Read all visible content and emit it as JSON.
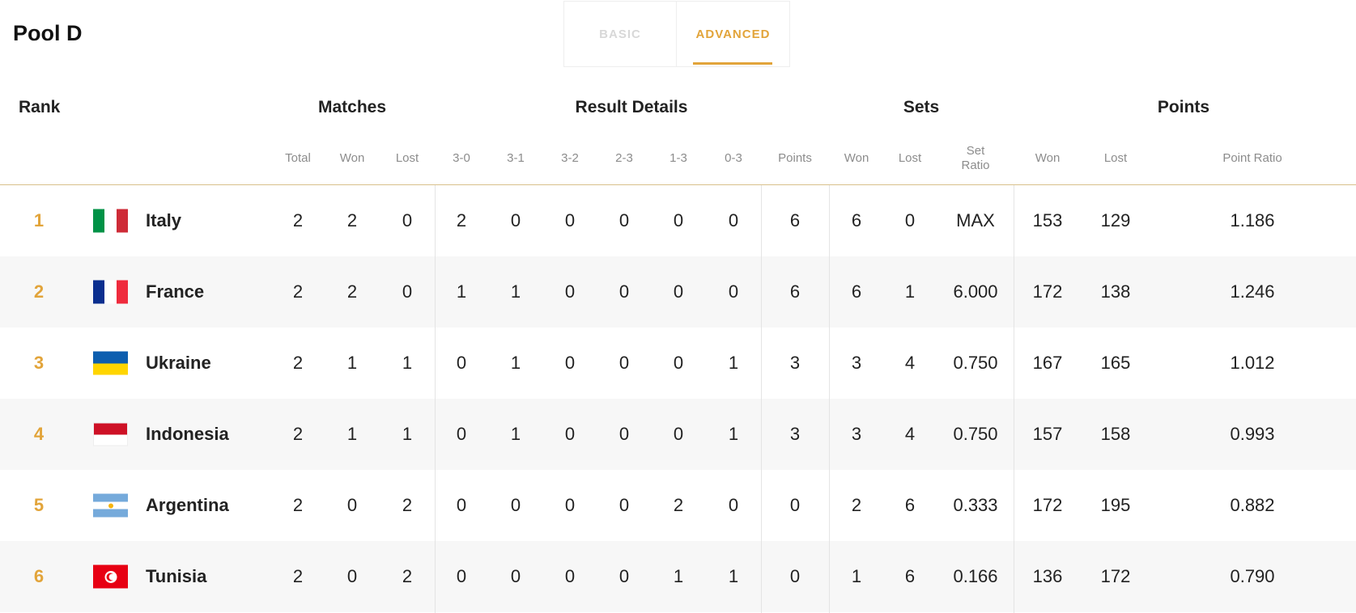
{
  "pool_title": "Pool D",
  "tabs": {
    "basic": "BASIC",
    "advanced": "ADVANCED",
    "active": "ADVANCED"
  },
  "accent_color": "#e2a43a",
  "groups": {
    "rank": "Rank",
    "matches": "Matches",
    "result_details": "Result Details",
    "sets": "Sets",
    "points": "Points"
  },
  "columns": {
    "matches_total": "Total",
    "matches_won": "Won",
    "matches_lost": "Lost",
    "r30": "3-0",
    "r31": "3-1",
    "r32": "3-2",
    "r23": "2-3",
    "r13": "1-3",
    "r03": "0-3",
    "points": "Points",
    "sets_won": "Won",
    "sets_lost": "Lost",
    "set_ratio": "Set Ratio",
    "points_won": "Won",
    "points_lost": "Lost",
    "point_ratio": "Point Ratio"
  },
  "rows": [
    {
      "rank": "1",
      "country": "Italy",
      "flag": "italy-flag-icon",
      "total": "2",
      "won": "2",
      "lost": "0",
      "r30": "2",
      "r31": "0",
      "r32": "0",
      "r23": "0",
      "r13": "0",
      "r03": "0",
      "points": "6",
      "sets_won": "6",
      "sets_lost": "0",
      "set_ratio": "MAX",
      "points_won": "153",
      "points_lost": "129",
      "point_ratio": "1.186"
    },
    {
      "rank": "2",
      "country": "France",
      "flag": "france-flag-icon",
      "total": "2",
      "won": "2",
      "lost": "0",
      "r30": "1",
      "r31": "1",
      "r32": "0",
      "r23": "0",
      "r13": "0",
      "r03": "0",
      "points": "6",
      "sets_won": "6",
      "sets_lost": "1",
      "set_ratio": "6.000",
      "points_won": "172",
      "points_lost": "138",
      "point_ratio": "1.246"
    },
    {
      "rank": "3",
      "country": "Ukraine",
      "flag": "ukraine-flag-icon",
      "total": "2",
      "won": "1",
      "lost": "1",
      "r30": "0",
      "r31": "1",
      "r32": "0",
      "r23": "0",
      "r13": "0",
      "r03": "1",
      "points": "3",
      "sets_won": "3",
      "sets_lost": "4",
      "set_ratio": "0.750",
      "points_won": "167",
      "points_lost": "165",
      "point_ratio": "1.012"
    },
    {
      "rank": "4",
      "country": "Indonesia",
      "flag": "indonesia-flag-icon",
      "total": "2",
      "won": "1",
      "lost": "1",
      "r30": "0",
      "r31": "1",
      "r32": "0",
      "r23": "0",
      "r13": "0",
      "r03": "1",
      "points": "3",
      "sets_won": "3",
      "sets_lost": "4",
      "set_ratio": "0.750",
      "points_won": "157",
      "points_lost": "158",
      "point_ratio": "0.993"
    },
    {
      "rank": "5",
      "country": "Argentina",
      "flag": "argentina-flag-icon",
      "total": "2",
      "won": "0",
      "lost": "2",
      "r30": "0",
      "r31": "0",
      "r32": "0",
      "r23": "0",
      "r13": "2",
      "r03": "0",
      "points": "0",
      "sets_won": "2",
      "sets_lost": "6",
      "set_ratio": "0.333",
      "points_won": "172",
      "points_lost": "195",
      "point_ratio": "0.882"
    },
    {
      "rank": "6",
      "country": "Tunisia",
      "flag": "tunisia-flag-icon",
      "total": "2",
      "won": "0",
      "lost": "2",
      "r30": "0",
      "r31": "0",
      "r32": "0",
      "r23": "0",
      "r13": "1",
      "r03": "1",
      "points": "0",
      "sets_won": "1",
      "sets_lost": "6",
      "set_ratio": "0.166",
      "points_won": "136",
      "points_lost": "172",
      "point_ratio": "0.790"
    }
  ]
}
